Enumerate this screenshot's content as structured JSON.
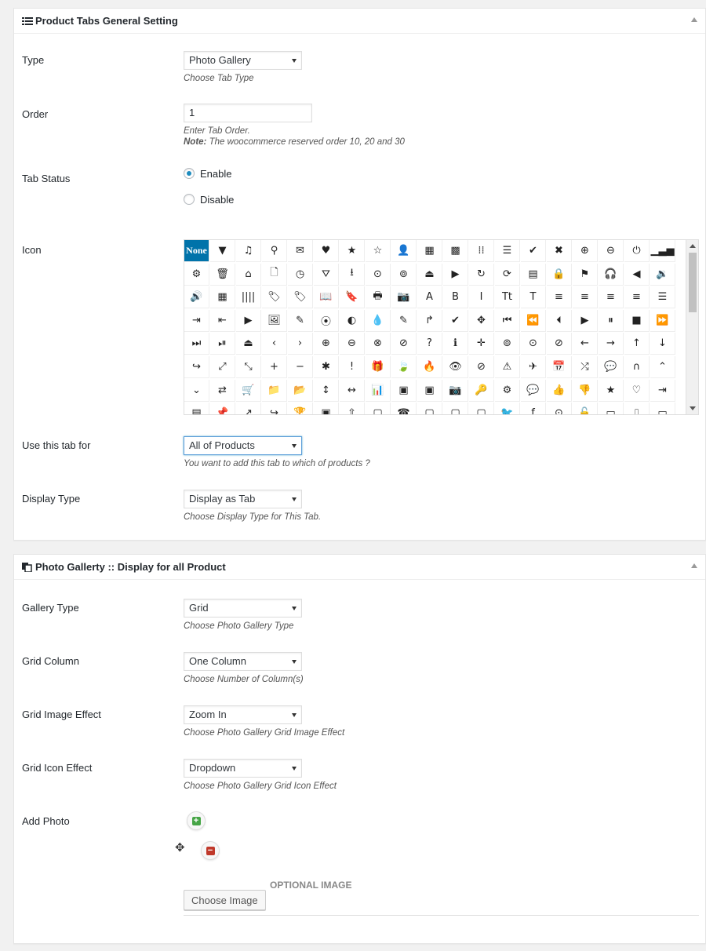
{
  "panel1": {
    "title": "Product Tabs General Setting",
    "type": {
      "label": "Type",
      "value": "Photo Gallery",
      "desc": "Choose Tab Type"
    },
    "order": {
      "label": "Order",
      "value": "1",
      "desc": "Enter Tab Order.",
      "note_bold": "Note:",
      "note": " The woocommerce reserved order 10, 20 and 30"
    },
    "status": {
      "label": "Tab Status",
      "enable": "Enable",
      "disable": "Disable",
      "selected": "Enable"
    },
    "icon": {
      "label": "Icon",
      "selected": "None",
      "glyphs": [
        "None",
        "▼",
        "♫",
        "⚲",
        "✉",
        "♥",
        "★",
        "☆",
        "👤",
        "▦",
        "▩",
        "⁞⁞",
        "☰",
        "✔",
        "✖",
        "⊕",
        "⊖",
        "⏻",
        "▁▃▅",
        "⚙",
        "🗑",
        "⌂",
        "🗋",
        "◷",
        "⛛",
        "⭳",
        "⊙",
        "⊚",
        "⏏",
        "▶",
        "↻",
        "⟳",
        "▤",
        "🔒",
        "⚑",
        "🎧",
        "◀",
        "🔉",
        "🔊",
        "▦",
        "||||",
        "🏷",
        "🏷",
        "📖",
        "🔖",
        "🖶",
        "📷",
        "A",
        "B",
        "I",
        "Tt",
        "T",
        "≡",
        "≡",
        "≡",
        "≡",
        "☰",
        "⇥",
        "⇤",
        "▶",
        "🖼",
        "✎",
        "⦿",
        "◐",
        "💧",
        "✎",
        "↱",
        "✔",
        "✥",
        "⏮",
        "⏪",
        "⏴",
        "▶",
        "⏸",
        "■",
        "⏩",
        "⏭",
        "⏯",
        "⏏",
        "‹",
        "›",
        "⊕",
        "⊖",
        "⊗",
        "⊘",
        "?",
        "ℹ",
        "✛",
        "⊚",
        "⊙",
        "⊘",
        "←",
        "→",
        "↑",
        "↓",
        "↪",
        "⤢",
        "⤡",
        "+",
        "−",
        "✱",
        "!",
        "🎁",
        "🍃",
        "🔥",
        "👁",
        "⊘",
        "⚠",
        "✈",
        "📅",
        "⤮",
        "💬",
        "∩",
        "⌃",
        "⌄",
        "⇄",
        "🛒",
        "📁",
        "📂",
        "↕",
        "↔",
        "📊",
        "▣",
        "▣",
        "📷",
        "🔑",
        "⚙",
        "💬",
        "👍",
        "👎",
        "★",
        "♡",
        "⇥",
        "▤",
        "📌",
        "↗",
        "↪",
        "🏆",
        "▣",
        "⇧",
        "▢",
        "☎",
        "▢",
        "▢",
        "▢",
        "🐦",
        "f",
        "⊙",
        "🔓",
        "▭",
        "⎍",
        "▭"
      ]
    },
    "use_for": {
      "label": "Use this tab for",
      "value": "All of Products",
      "desc": "You want to add this tab to which of products ?"
    },
    "display_type": {
      "label": "Display Type",
      "value": "Display as Tab",
      "desc": "Choose Display Type for This Tab."
    }
  },
  "panel2": {
    "title": "Photo Gallerty :: Display for all Product",
    "gallery_type": {
      "label": "Gallery Type",
      "value": "Grid",
      "desc": "Choose Photo Gallery Type"
    },
    "grid_column": {
      "label": "Grid Column",
      "value": "One Column",
      "desc": "Choose Number of Column(s)"
    },
    "grid_image_effect": {
      "label": "Grid Image Effect",
      "value": "Zoom In",
      "desc": "Choose Photo Gallery Grid Image Effect"
    },
    "grid_icon_effect": {
      "label": "Grid Icon Effect",
      "value": "Dropdown",
      "desc": "Choose Photo Gallery Grid Icon Effect"
    },
    "add_photo": {
      "label": "Add Photo",
      "optional_label": "OPTIONAL IMAGE",
      "choose_button": "Choose Image"
    }
  },
  "colors": {
    "accent": "#0073aa",
    "add": "#46a546",
    "remove": "#c0392b"
  }
}
